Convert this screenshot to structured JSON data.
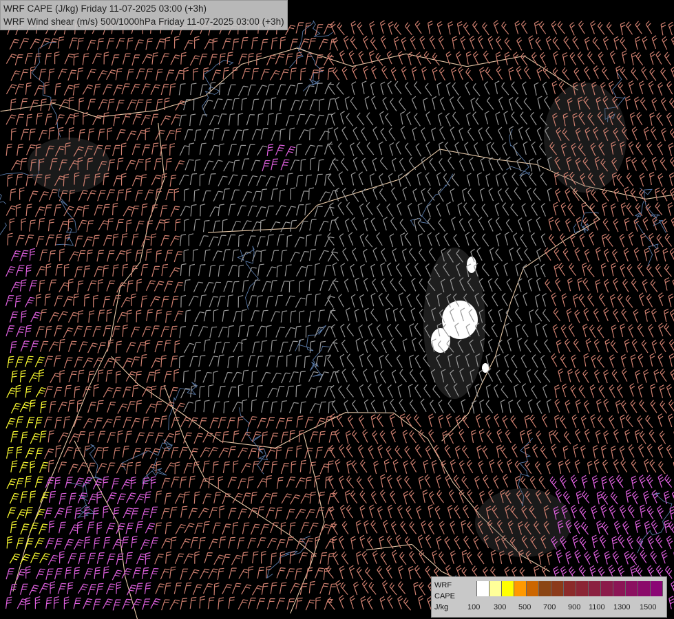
{
  "header": {
    "line1": "WRF CAPE (J/kg) Friday 11-07-2025 03:00 (+3h)",
    "line2": "WRF Wind shear (m/s) 500/1000hPa Friday 11-07-2025 03:00 (+3h)"
  },
  "legend": {
    "labels": [
      "WRF",
      "CAPE",
      "J/kg"
    ],
    "ticks": [
      "100",
      "300",
      "500",
      "700",
      "900",
      "1100",
      "1300",
      "1500"
    ],
    "colors": [
      "#c8c8c8",
      "#ffffff",
      "#ffff99",
      "#ffff00",
      "#ff9900",
      "#cc6600",
      "#8b4513",
      "#8b3a1a",
      "#8b2a2a",
      "#8b2535",
      "#8b2040",
      "#8b1b4a",
      "#8b1555",
      "#8b1060",
      "#8b0a6a",
      "#8b0575"
    ]
  },
  "map": {
    "background": "#000000",
    "border_color": "#e8c9a8",
    "river_color": "#5a7aa8",
    "barb_colors": {
      "weak": "#9a9a9a",
      "moderate": "#d08070",
      "strong": "#e060e0",
      "very_strong": "#ffff33"
    }
  }
}
